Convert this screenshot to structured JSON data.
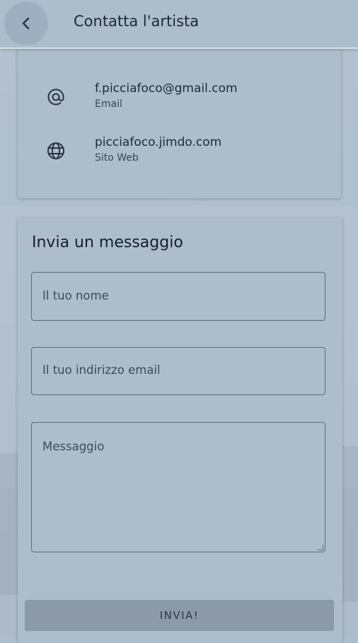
{
  "header": {
    "title": "Contatta l'artista",
    "back_icon": "chevron-left-icon"
  },
  "contact": {
    "items": [
      {
        "icon": "at-sign-icon",
        "value": "f.picciafoco@gmail.com",
        "label": "Email"
      },
      {
        "icon": "globe-icon",
        "value": "picciafoco.jimdo.com",
        "label": "Sito Web"
      }
    ]
  },
  "form": {
    "title": "Invia un messaggio",
    "name_placeholder": "Il tuo nome",
    "email_placeholder": "Il tuo indirizzo email",
    "message_placeholder": "Messaggio",
    "send_label": "INVIA!"
  },
  "colors": {
    "background": "#aebdcc",
    "button": "#8c99a6",
    "text": "#1f2a36"
  }
}
